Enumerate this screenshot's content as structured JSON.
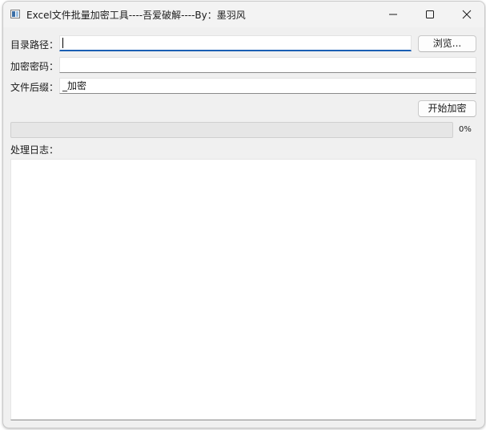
{
  "window": {
    "title": "Excel文件批量加密工具----吾爱破解----By：墨羽风"
  },
  "form": {
    "dir_label": "目录路径：",
    "dir_value": "",
    "browse_label": "浏览...",
    "password_label": "加密密码：",
    "password_value": "",
    "suffix_label": "文件后缀：",
    "suffix_value": "_加密",
    "start_label": "开始加密"
  },
  "progress": {
    "value": 0,
    "text": "0%"
  },
  "log": {
    "label": "处理日志：",
    "content": ""
  },
  "colors": {
    "window_bg": "#f0f0f0",
    "accent": "#1a5fb4"
  },
  "icons": {
    "app": "app-icon",
    "minimize": "minimize-icon",
    "maximize": "maximize-icon",
    "close": "close-icon"
  }
}
